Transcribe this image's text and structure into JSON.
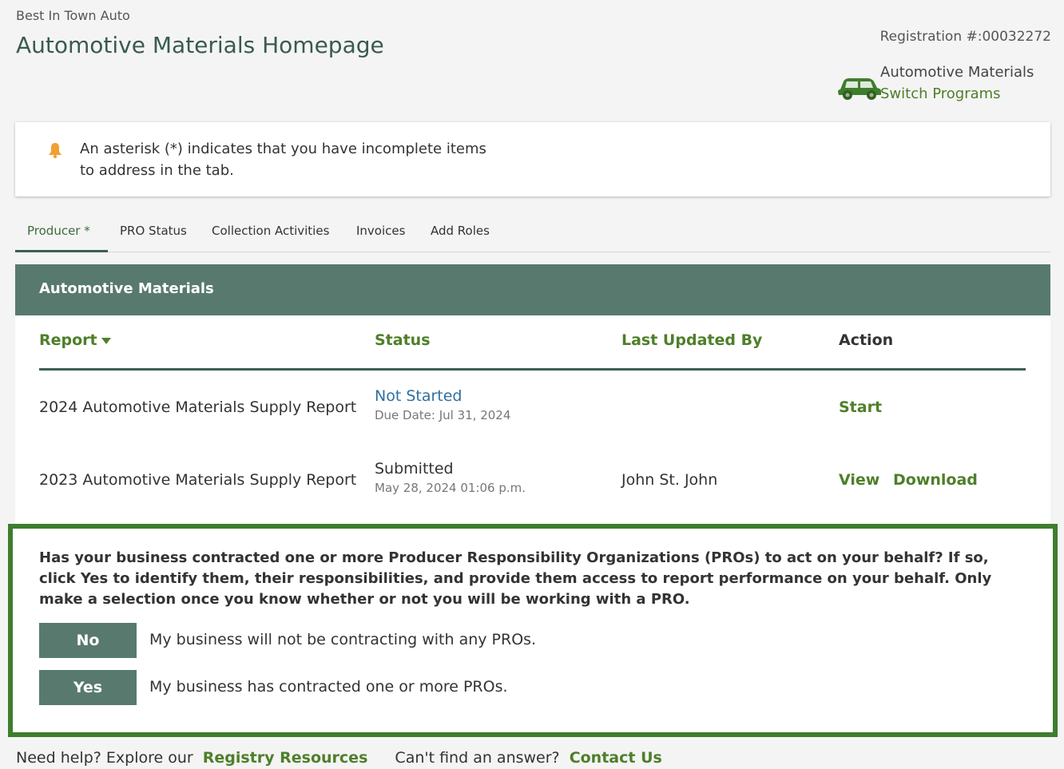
{
  "header": {
    "org_name": "Best In Town Auto",
    "title": "Automotive Materials Homepage",
    "registration": "Registration #:00032272",
    "program_name": "Automotive Materials",
    "switch_label": "Switch Programs",
    "program_icon": "car-icon"
  },
  "notice": {
    "icon": "bell-icon",
    "text": "An asterisk (*) indicates that you have incomplete items to address in the tab."
  },
  "tabs": [
    {
      "label": "Producer *",
      "active": true
    },
    {
      "label": "PRO Status",
      "active": false
    },
    {
      "label": "Collection Activities",
      "active": false
    },
    {
      "label": "Invoices",
      "active": false
    },
    {
      "label": "Add Roles",
      "active": false
    }
  ],
  "panel": {
    "title": "Automotive Materials",
    "columns": {
      "report": "Report",
      "status": "Status",
      "last_updated_by": "Last Updated By",
      "action": "Action"
    },
    "rows": [
      {
        "report": "2024 Automotive Materials Supply Report",
        "status": "Not Started",
        "status_sub": "Due Date: Jul 31, 2024",
        "last_updated_by": "",
        "actions": [
          "Start"
        ]
      },
      {
        "report": "2023 Automotive Materials Supply Report",
        "status": "Submitted",
        "status_sub": "May 28, 2024 01:06 p.m.",
        "last_updated_by": "John St. John",
        "actions": [
          "View",
          "Download"
        ]
      }
    ]
  },
  "pro": {
    "question": "Has your business contracted one or more Producer Responsibility Organizations (PROs) to act on your behalf? If so, click Yes to identify them, their responsibilities, and provide them access to report performance on your behalf. Only make a selection once you know whether or not you will be working with a PRO.",
    "no_label": "No",
    "no_desc": "My business will not be contracting with any PROs.",
    "yes_label": "Yes",
    "yes_desc": "My business has contracted one or more PROs."
  },
  "help": {
    "prefix": "Need help? Explore our",
    "resources_link": "Registry Resources",
    "middle": "Can't find an answer?",
    "contact_link": "Contact Us"
  },
  "colors": {
    "accent_green": "#4e7f2a",
    "header_teal": "#587a6e",
    "highlight_border": "#3e7d2e",
    "link_blue": "#2f6f9f",
    "bell_orange": "#f0a030"
  }
}
